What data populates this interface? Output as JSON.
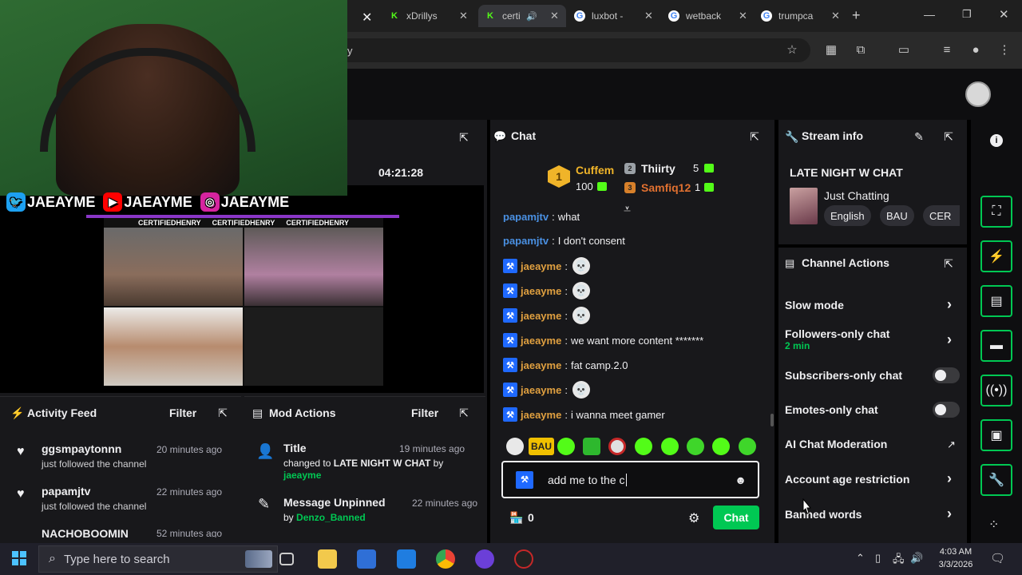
{
  "browser": {
    "tabs": [
      {
        "label": "xDrillys",
        "fav_color": "#53fc18",
        "fav_glyph": "K"
      },
      {
        "label": "certi",
        "fav_color": "#53fc18",
        "fav_glyph": "K",
        "active": true
      },
      {
        "label": "luxbot -",
        "fav_color": "#ffffff",
        "fav_glyph": "G"
      },
      {
        "label": "wetback",
        "fav_color": "#ffffff",
        "fav_glyph": "G"
      },
      {
        "label": "trumpca",
        "fav_color": "#ffffff",
        "fav_glyph": "G"
      }
    ],
    "new_tab_symbol": "+",
    "url_fragment": "y"
  },
  "overlay": {
    "socials": [
      {
        "handle": "JAEAYME",
        "icon": "twitter-icon",
        "color": "#1da1f2"
      },
      {
        "handle": "JAEAYME",
        "icon": "youtube-icon",
        "color": "#ff0000"
      },
      {
        "handle": "JAEAYME",
        "icon": "instagram-icon",
        "color": "#d6249f"
      }
    ],
    "credits": [
      "CERTIFIEDHENRY",
      "CERTIFIEDHENRY",
      "CERTIFIEDHENRY"
    ]
  },
  "video": {
    "uptime": "04:21:28"
  },
  "activity_feed": {
    "title": "Activity Feed",
    "filter_label": "Filter",
    "items": [
      {
        "name": "ggsmpaytonnn",
        "action": "just followed the channel",
        "ago": "20 minutes ago"
      },
      {
        "name": "papamjtv",
        "action": "just followed the channel",
        "ago": "22 minutes ago"
      },
      {
        "name": "NACHOBOOMIN",
        "action": "",
        "ago": "52 minutes ago"
      }
    ]
  },
  "mod_actions": {
    "title": "Mod Actions",
    "filter_label": "Filter",
    "items": [
      {
        "title": "Title",
        "detail_prefix": "changed to",
        "detail_value": "LATE NIGHT W CHAT",
        "by_prefix": "by",
        "by": "jaeayme",
        "ago": "19 minutes ago"
      },
      {
        "title": "Message Unpinned",
        "by_prefix": "by",
        "by": "Denzo_Banned",
        "ago": "22 minutes ago"
      }
    ]
  },
  "chat": {
    "title": "Chat",
    "leaderboard": {
      "first": {
        "rank": "1",
        "name": "Cuffem",
        "points": "100"
      },
      "second": {
        "rank": "2",
        "name": "Thiirty",
        "points": "5"
      },
      "third": {
        "rank": "3",
        "name": "Samfiq12",
        "points": "1"
      }
    },
    "messages": [
      {
        "user": "papamjtv",
        "text": "what",
        "badge": false,
        "skull": false
      },
      {
        "user": "papamjtv",
        "text": "I don't consent",
        "badge": false,
        "skull": false
      },
      {
        "user": "jaeayme",
        "text": "",
        "badge": true,
        "skull": true
      },
      {
        "user": "jaeayme",
        "text": "",
        "badge": true,
        "skull": true
      },
      {
        "user": "jaeayme",
        "text": "",
        "badge": true,
        "skull": true
      },
      {
        "user": "jaeayme",
        "text": "we want more content *******",
        "badge": true,
        "skull": false
      },
      {
        "user": "jaeayme",
        "text": "fat camp.2.0",
        "badge": true,
        "skull": false
      },
      {
        "user": "jaeayme",
        "text": "",
        "badge": true,
        "skull": true
      },
      {
        "user": "jaeayme",
        "text": "i wanna meet gamer",
        "badge": true,
        "skull": false
      }
    ],
    "emote_bau": "BAU",
    "input_value": "add me to the c",
    "points": "0",
    "send_label": "Chat"
  },
  "stream_info": {
    "title": "Stream info",
    "stream_title": "LATE NIGHT W CHAT",
    "category": "Just Chatting",
    "tags": [
      "English",
      "BAU",
      "CER"
    ]
  },
  "channel_actions": {
    "title": "Channel Actions",
    "items": [
      {
        "label": "Slow mode",
        "kind": "chevron"
      },
      {
        "label": "Followers-only chat",
        "sub": "2 min",
        "kind": "chevron"
      },
      {
        "label": "Subscribers-only chat",
        "kind": "toggle",
        "on": false
      },
      {
        "label": "Emotes-only chat",
        "kind": "toggle",
        "on": false
      },
      {
        "label": "AI Chat Moderation",
        "kind": "external"
      },
      {
        "label": "Account age restriction",
        "kind": "chevron"
      },
      {
        "label": "Banned words",
        "kind": "chevron"
      }
    ]
  },
  "taskbar": {
    "search_placeholder": "Type here to search",
    "time": "4:03 AM",
    "date": "3/3/2026"
  },
  "colors": {
    "accent_green": "#00c853",
    "panel_bg": "#18181b",
    "page_bg": "#0e0e10"
  }
}
